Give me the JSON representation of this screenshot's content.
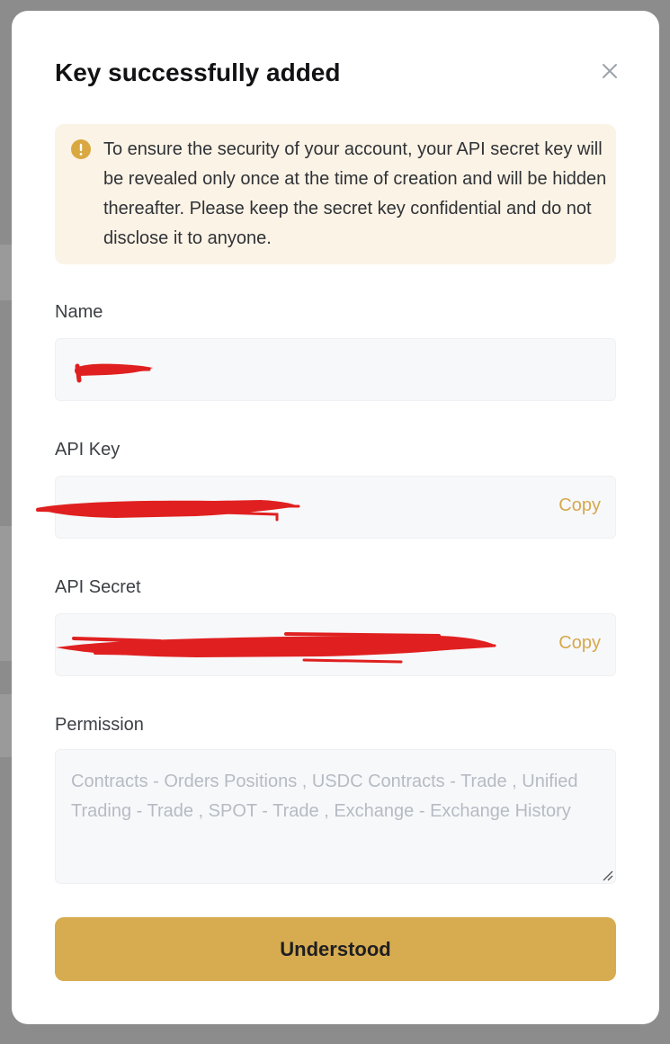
{
  "modal": {
    "title": "Key successfully added",
    "notice": "To ensure the security of your account, your API secret key will be revealed only once at the time of creation and will be hidden thereafter. Please keep the secret key confidential and do not disclose it to anyone.",
    "name_label": "Name",
    "api_key_label": "API Key",
    "api_secret_label": "API Secret",
    "copy_label": "Copy",
    "permission_label": "Permission",
    "permission_value": "Contracts - Orders Positions  , USDC Contracts - Trade  , Unified Trading - Trade  , SPOT - Trade  , Exchange - Exchange History",
    "confirm_label": "Understood"
  },
  "icons": {
    "close": "close-icon",
    "notice": "warning-icon",
    "resize": "resize-handle-icon"
  },
  "colors": {
    "accent": "#d7ac50",
    "copy_link": "#d6a84d",
    "notice_bg": "#fbf3e6",
    "notice_icon": "#d9a841",
    "redaction": "#e02020"
  }
}
